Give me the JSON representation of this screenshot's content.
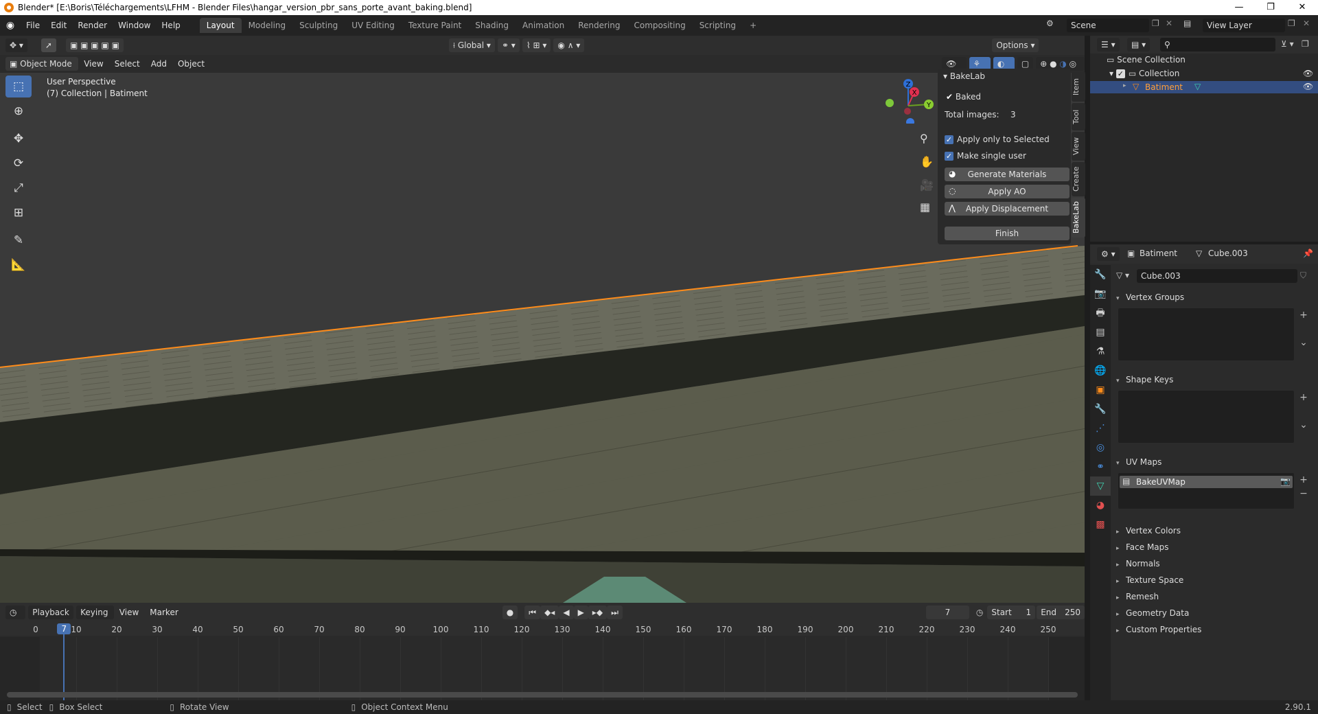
{
  "titlebar": {
    "title": "Blender* [E:\\Boris\\Téléchargements\\LFHM - Blender Files\\hangar_version_pbr_sans_porte_avant_baking.blend]",
    "minimize": "—",
    "maximize": "❐",
    "close": "✕"
  },
  "menubar": {
    "menus": [
      "File",
      "Edit",
      "Render",
      "Window",
      "Help"
    ],
    "workspaces": [
      "Layout",
      "Modeling",
      "Sculpting",
      "UV Editing",
      "Texture Paint",
      "Shading",
      "Animation",
      "Rendering",
      "Compositing",
      "Scripting"
    ],
    "active_workspace": "Layout",
    "add_workspace": "+",
    "scene": "Scene",
    "view_layer": "View Layer"
  },
  "viewport_header": {
    "transform_orientation": "Global",
    "options": "Options",
    "mode": "Object Mode",
    "menus": [
      "View",
      "Select",
      "Add",
      "Object"
    ]
  },
  "viewport": {
    "perspective": "User Perspective",
    "collection_info": "(7) Collection | Batiment",
    "gizmo": {
      "x": "X",
      "y": "Y",
      "z": "Z"
    },
    "selection_outline_color": "#ff8c1a"
  },
  "bakelab": {
    "title": "BakeLab",
    "baked_label": "Baked",
    "total_images_label": "Total images:",
    "total_images_value": "3",
    "apply_only_selected": "Apply only to Selected",
    "make_single_user": "Make single user",
    "generate_materials": "Generate Materials",
    "apply_ao": "Apply AO",
    "apply_displacement": "Apply Displacement",
    "finish": "Finish"
  },
  "sidebar_tabs": [
    "Item",
    "Tool",
    "View",
    "Create",
    "BakeLab"
  ],
  "active_sidebar_tab": "BakeLab",
  "outliner": {
    "root": "Scene Collection",
    "collection": "Collection",
    "object": "Batiment"
  },
  "properties": {
    "object_name": "Batiment",
    "mesh_name": "Cube.003",
    "mesh_field": "Cube.003",
    "sections": {
      "vertex_groups": "Vertex Groups",
      "shape_keys": "Shape Keys",
      "uv_maps": "UV Maps",
      "vertex_colors": "Vertex Colors",
      "face_maps": "Face Maps",
      "normals": "Normals",
      "texture_space": "Texture Space",
      "remesh": "Remesh",
      "geometry_data": "Geometry Data",
      "custom_properties": "Custom Properties"
    },
    "uv_map_item": "BakeUVMap"
  },
  "timeline": {
    "menus": [
      "Playback",
      "Keying",
      "View",
      "Marker"
    ],
    "current_frame": "7",
    "start_label": "Start",
    "start_value": "1",
    "end_label": "End",
    "end_value": "250",
    "ticks": [
      "0",
      "10",
      "20",
      "30",
      "40",
      "50",
      "60",
      "70",
      "80",
      "90",
      "100",
      "110",
      "120",
      "130",
      "140",
      "150",
      "160",
      "170",
      "180",
      "190",
      "200",
      "210",
      "220",
      "230",
      "240",
      "250"
    ],
    "playhead_label": "7"
  },
  "statusbar": {
    "select": "Select",
    "box_select": "Box Select",
    "rotate_view": "Rotate View",
    "context_menu": "Object Context Menu",
    "version": "2.90.1"
  },
  "colors": {
    "accent": "#4772b3",
    "selection": "#ff8c1a",
    "mesh_data": "#3fd2b0"
  }
}
